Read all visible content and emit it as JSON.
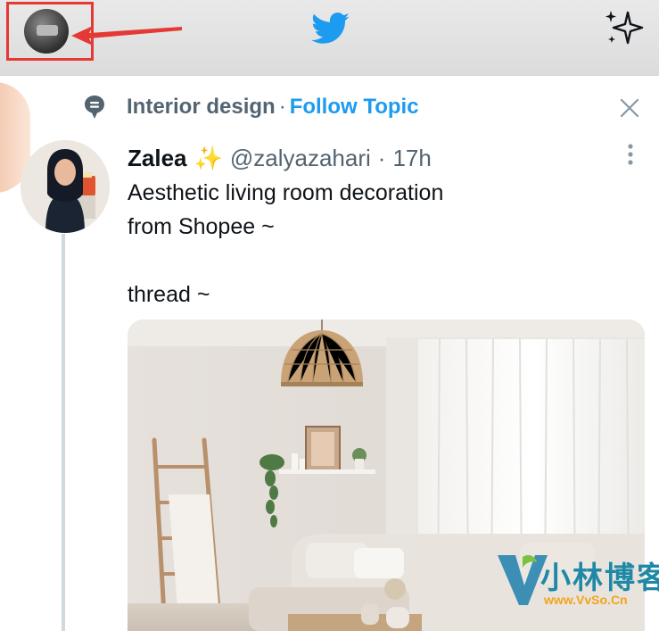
{
  "topic": {
    "name": "Interior design",
    "separator": "·",
    "follow_label": "Follow Topic"
  },
  "tweet": {
    "display_name": "Zalea",
    "name_emoji": "✨",
    "handle": "@zalyazahari",
    "separator": "·",
    "time": "17h",
    "text_lines": [
      "Aesthetic living room decoration",
      "from Shopee ~",
      "",
      "thread ~"
    ]
  },
  "watermark": {
    "main": "小林博客",
    "url": "www.VvSo.Cn"
  },
  "icons": {
    "logo": "twitter-bird-icon",
    "top_right": "sparkle-icon",
    "topic": "topic-bubble-icon",
    "close": "close-icon",
    "more": "more-vertical-icon"
  },
  "colors": {
    "accent": "#1d9bf0",
    "highlight": "#e53935",
    "secondary_text": "#536471"
  }
}
